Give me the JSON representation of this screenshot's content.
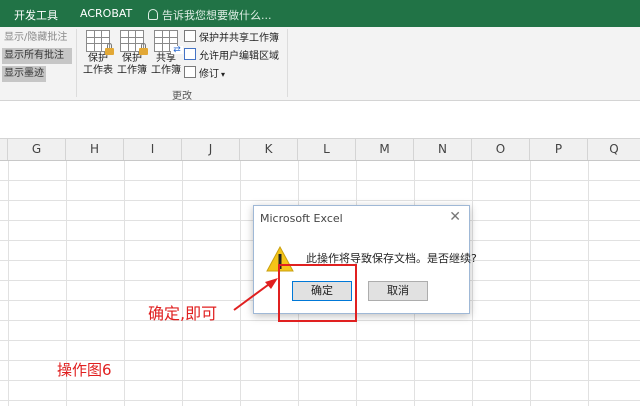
{
  "tabs": [
    "开发工具",
    "ACROBAT"
  ],
  "tellme": "告诉我您想要做什么...",
  "comments": {
    "show_hide": "显示/隐藏批注",
    "show_all": "显示所有批注",
    "show_ink": "显示墨迹"
  },
  "changes": {
    "protect_sheet": [
      "保护",
      "工作表"
    ],
    "protect_book": [
      "保护",
      "工作簿"
    ],
    "share_book": [
      "共享",
      "工作簿"
    ],
    "protect_share": "保护并共享工作簿",
    "allow_edit": "允许用户编辑区域",
    "track": "修订",
    "group_label": "更改"
  },
  "columns": [
    "G",
    "H",
    "I",
    "J",
    "K",
    "L",
    "M",
    "N",
    "O",
    "P",
    "Q"
  ],
  "dialog": {
    "title": "Microsoft Excel",
    "close": "✕",
    "message": "此操作将导致保存文档。是否继续?",
    "ok": "确定",
    "cancel": "取消"
  },
  "annotation": "确定,即可",
  "caption": "操作图6",
  "colors": {
    "ribbon_green": "#217346",
    "annotation_red": "#e02020"
  }
}
